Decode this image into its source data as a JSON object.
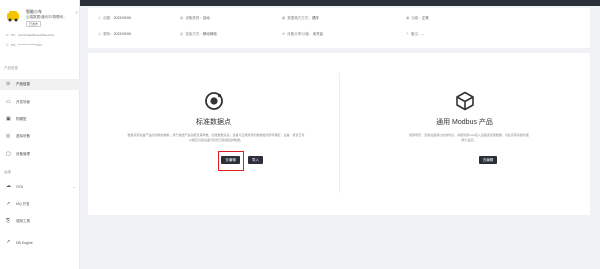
{
  "sidebar": {
    "product_name": "智能小车",
    "product_sub": "云端数据/通讯中/物联网...",
    "product_tag": "已发布",
    "meta": [
      {
        "icon": "id-icon",
        "text": "PK：/Leh/c/4aaf0e4ea56aed/1C..."
      },
      {
        "icon": "key-icon",
        "text": "PS：****************b4d"
      }
    ],
    "section_product": "产品信息",
    "items_product": [
      {
        "label": "产品信息",
        "icon": "info-icon"
      },
      {
        "label": "开发场景",
        "icon": "code-icon"
      },
      {
        "label": "物模型",
        "icon": "model-icon"
      },
      {
        "label": "虚拟设备",
        "icon": "device-icon"
      },
      {
        "label": "设备管理",
        "icon": "manage-icon"
      }
    ],
    "section_ops": "运维",
    "items_ops": [
      {
        "label": "OTA",
        "icon": "ota-icon",
        "chevron": "⌄"
      },
      {
        "label": "MQ 开发",
        "icon": "mq-icon"
      },
      {
        "label": "调用工具",
        "icon": "tool-icon"
      },
      {
        "label": "DB Engine",
        "icon": "db-icon"
      }
    ],
    "collapse": "‹"
  },
  "info": {
    "row1": [
      {
        "label": "创建：",
        "value": "2022/09/06",
        "icon": "clock-icon"
      },
      {
        "label": "设备类别：",
        "value": "自动",
        "icon": "type-icon"
      },
      {
        "label": "数据格式方式：",
        "value": "透传",
        "icon": "data-icon"
      },
      {
        "label": "功能：",
        "value": "正常",
        "icon": "status-icon"
      }
    ],
    "row2": [
      {
        "label": "更新：",
        "value": "2022/09/06",
        "icon": "clock-icon"
      },
      {
        "label": "连接方式：",
        "value": "移动网络",
        "icon": "net-icon"
      },
      {
        "label": "设备分享/功能：",
        "value": "未开启",
        "icon": "share-icon"
      },
      {
        "label": "备注：",
        "value": "--",
        "icon": "note-icon"
      }
    ]
  },
  "cards": {
    "standard": {
      "title": "标准数据点",
      "desc_line1": "数据点即设备产品的功能的抽象，用于描述产品功能及其参数。创建数据点后，设备与云端通讯的数据格式即可确定，设备、机智云可",
      "desc_line2": "以相互识别设备与机智云联通后的数据。",
      "btn_edit": "去编辑",
      "btn_import": "导入"
    },
    "modbus": {
      "title": "通用 Modbus 产品",
      "desc_line1": "使用场景：该类设备通过总线协议，并能利用mqtt接入设备连接或数据，对此实现基础功能",
      "desc_line2": "能力设定。",
      "btn_edit": "去编辑"
    }
  },
  "colors": {
    "accent": "#2b2f3a",
    "highlight": "#e02020",
    "logo": "#f5c400"
  }
}
